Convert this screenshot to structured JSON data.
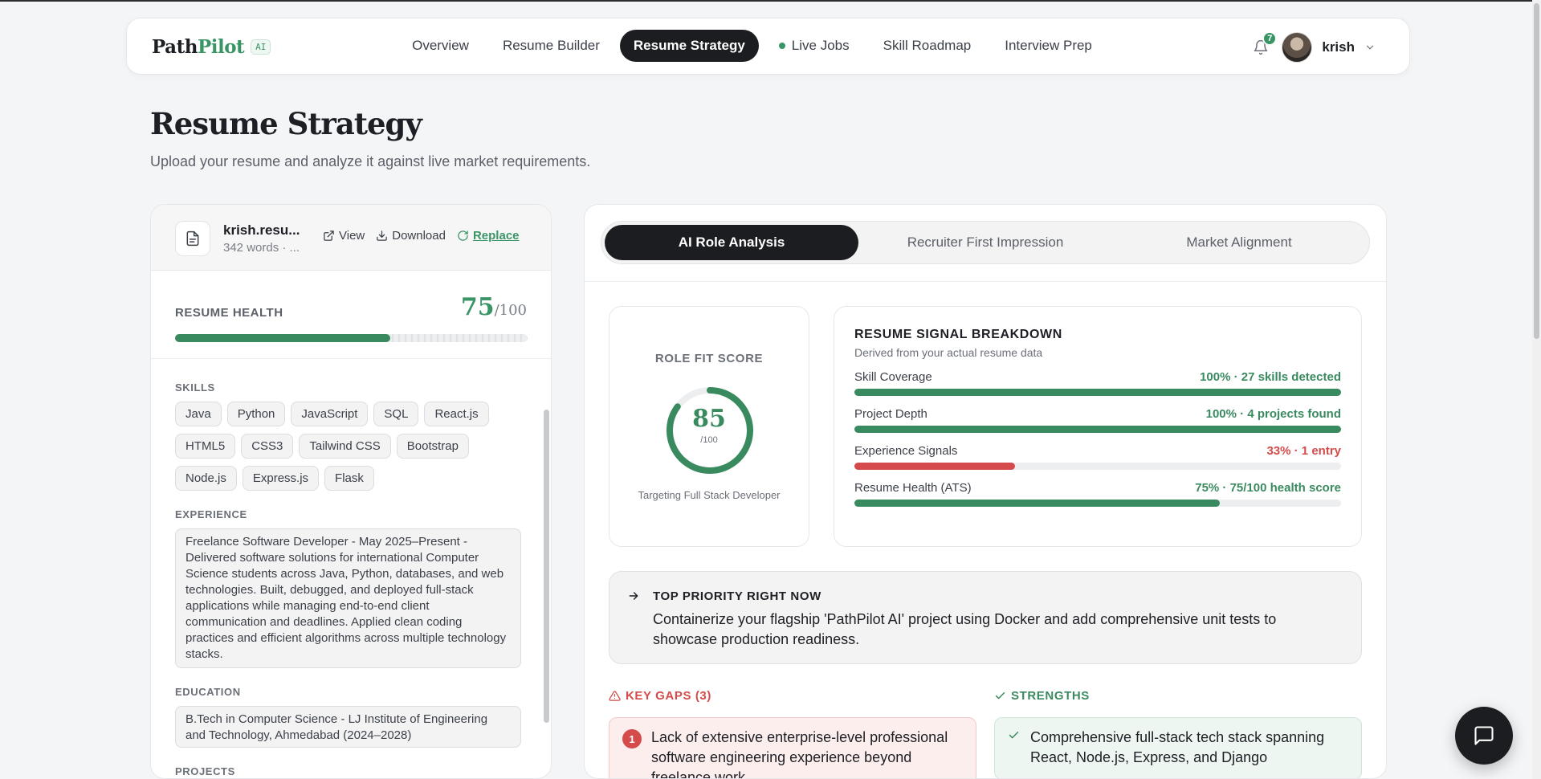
{
  "app": {
    "logo_main": "Path",
    "logo_accent": "Pilot",
    "logo_badge": "AI"
  },
  "nav": {
    "links": [
      {
        "label": "Overview",
        "active": false
      },
      {
        "label": "Resume Builder",
        "active": false
      },
      {
        "label": "Resume Strategy",
        "active": true
      },
      {
        "label": "Live Jobs",
        "active": false
      },
      {
        "label": "Skill Roadmap",
        "active": false
      },
      {
        "label": "Interview Prep",
        "active": false
      }
    ],
    "notification_count": "7",
    "user_name": "krish"
  },
  "header": {
    "title": "Resume Strategy",
    "subtitle": "Upload your resume and analyze it against live market requirements."
  },
  "file": {
    "name": "krish.resu...",
    "meta": "342 words · ...",
    "view_label": "View",
    "download_label": "Download",
    "replace_label": "Replace"
  },
  "health": {
    "label": "RESUME HEALTH",
    "score": "75",
    "max": "/100",
    "fraction": 0.61
  },
  "resume": {
    "skills_label": "SKILLS",
    "skills": [
      "Java",
      "Python",
      "JavaScript",
      "SQL",
      "React.js",
      "HTML5",
      "CSS3",
      "Tailwind CSS",
      "Bootstrap",
      "Node.js",
      "Express.js",
      "Flask"
    ],
    "experience_label": "EXPERIENCE",
    "experience_text": "Freelance Software Developer - May 2025–Present - Delivered software solutions for international Computer Science students across Java, Python, databases, and web technologies. Built, debugged, and deployed full-stack applications while managing end-to-end client communication and deadlines. Applied clean coding practices and efficient algorithms across multiple technology stacks.",
    "education_label": "EDUCATION",
    "education_text": "B.Tech in Computer Science - LJ Institute of Engineering and Technology, Ahmedabad (2024–2028)",
    "projects_label": "PROJECTS"
  },
  "tabs": [
    {
      "label": "AI Role Analysis",
      "active": true
    },
    {
      "label": "Recruiter First Impression",
      "active": false
    },
    {
      "label": "Market Alignment",
      "active": false
    }
  ],
  "role_fit": {
    "label": "ROLE FIT SCORE",
    "score": "85",
    "max": "/100",
    "fraction": 0.85,
    "target": "Targeting Full Stack Developer"
  },
  "signals": {
    "title": "RESUME SIGNAL BREAKDOWN",
    "subtitle": "Derived from your actual resume data",
    "items": [
      {
        "name": "Skill Coverage",
        "value": "100% · 27 skills detected",
        "fraction": 1.0,
        "color": "#3a8a5f"
      },
      {
        "name": "Project Depth",
        "value": "100% · 4 projects found",
        "fraction": 1.0,
        "color": "#3a8a5f"
      },
      {
        "name": "Experience Signals",
        "value": "33% · 1 entry",
        "fraction": 0.33,
        "color": "#d54a4a"
      },
      {
        "name": "Resume Health (ATS)",
        "value": "75% · 75/100 health score",
        "fraction": 0.75,
        "color": "#3a8a5f"
      }
    ]
  },
  "priority": {
    "title": "TOP PRIORITY RIGHT NOW",
    "body": "Containerize your flagship 'PathPilot AI' project using Docker and add comprehensive unit tests to showcase production readiness."
  },
  "gaps": {
    "title": "KEY GAPS (3)",
    "items": [
      {
        "num": "1",
        "text": "Lack of extensive enterprise-level professional software engineering experience beyond freelance work."
      }
    ]
  },
  "strengths": {
    "title": "STRENGTHS",
    "items": [
      {
        "text": "Comprehensive full-stack tech stack spanning React, Node.js, Express, and Django"
      }
    ]
  },
  "colors": {
    "accent": "#3a9566",
    "dark": "#1c1d20",
    "danger": "#d54a4a"
  }
}
